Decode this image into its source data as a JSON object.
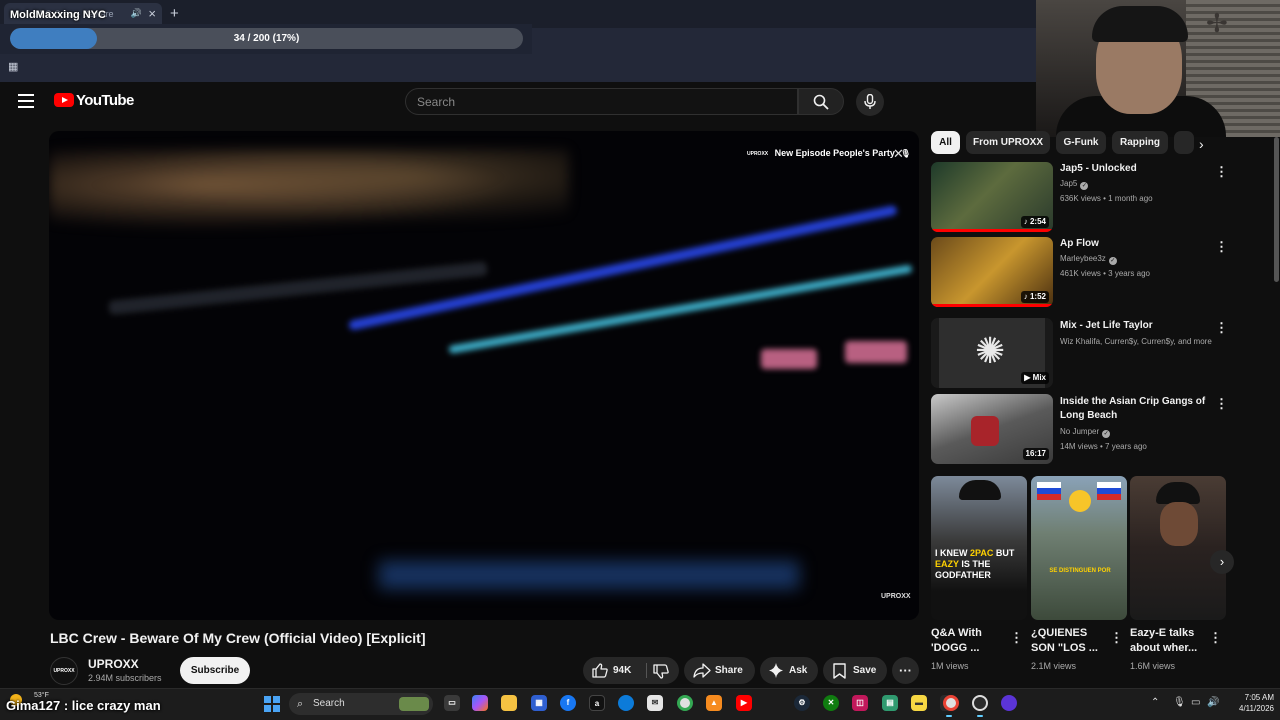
{
  "browser": {
    "tab_title": "LBC Crew - Beware",
    "overlay_title": "MoldMaxxing NYC",
    "progress": {
      "text": "34 / 200 (17%)",
      "fraction": 0.17
    }
  },
  "youtube": {
    "logo_text": "YouTube",
    "search_placeholder": "Search"
  },
  "video": {
    "promo_brand": "UPROXX",
    "promo_text": "New Episode People's Party",
    "watermark": "UPROXX",
    "title": "LBC Crew - Beware Of My Crew (Official Video) [Explicit]",
    "channel": {
      "name": "UPROXX",
      "subscribers": "2.94M subscribers",
      "avatar_text": "UPROXX"
    },
    "subscribe_label": "Subscribe",
    "likes": "94K",
    "share_label": "Share",
    "ask_label": "Ask",
    "save_label": "Save"
  },
  "chips": [
    "All",
    "From UPROXX",
    "G-Funk",
    "Rapping"
  ],
  "recommendations": [
    {
      "title": "Jap5 - Unlocked",
      "channel": "Jap5",
      "verified": true,
      "meta": "636K views • 1 month ago",
      "duration": "2:54"
    },
    {
      "title": "Ap Flow",
      "channel": "Marleybee3z",
      "verified": true,
      "meta": "461K views • 3 years ago",
      "duration": "1:52"
    },
    {
      "title": "Mix - Jet Life Taylor",
      "channel": "Wiz Khalifa, Curren$y, Curren$y, and more",
      "verified": false,
      "meta": "",
      "duration": "Mix"
    },
    {
      "title": "Inside the Asian Crip Gangs of Long Beach",
      "channel": "No Jumper",
      "verified": true,
      "meta": "14M views • 7 years ago",
      "duration": "16:17"
    }
  ],
  "shorts": [
    {
      "title": "Q&A With 'DOGG ...",
      "views": "1M views",
      "caption": [
        "I KNEW ",
        "2PAC",
        " BUT ",
        "EAZY",
        " IS THE GODFATHER"
      ]
    },
    {
      "title": "¿QUIENES SON \"LOS ...",
      "views": "2.1M views",
      "caption": [
        "SE DISTINGUEN POR"
      ]
    },
    {
      "title": "Eazy-E talks about wher...",
      "views": "1.6M views",
      "caption": []
    }
  ],
  "taskbar": {
    "weather_temp": "53°F",
    "chat_overlay": "Gima127 : lice crazy man",
    "search_label": "Search",
    "time": "7:05 AM",
    "date": "4/11/2026"
  },
  "colors": {
    "youtube_red": "#ff0000",
    "background": "#0f0f0f",
    "progress_fill": "#3f7ec0",
    "taskbar": "#1c1c1c"
  }
}
